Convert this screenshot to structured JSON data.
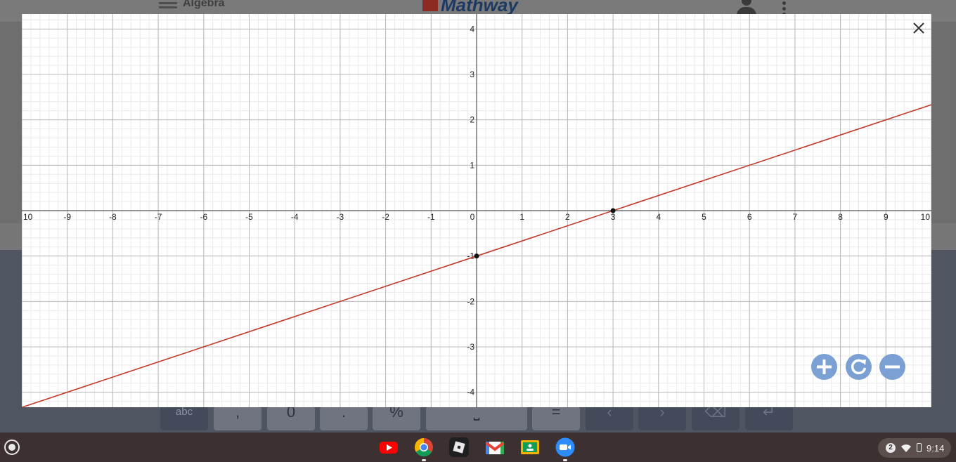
{
  "background_app": {
    "section_title": "Algebra",
    "logo_text": "Mathway",
    "keypad": [
      ",",
      "0",
      ".",
      "%",
      "⎵",
      "="
    ],
    "keypad_mode_label": "abc",
    "nav_keys": [
      "‹",
      "›",
      "⌫",
      "↵"
    ]
  },
  "graph": {
    "x_range": [
      -10,
      10
    ],
    "y_range": [
      -4.33,
      4.33
    ],
    "x_tick_labels": [
      "10",
      "-9",
      "-8",
      "-7",
      "-6",
      "-5",
      "-4",
      "-3",
      "-2",
      "-1",
      "0",
      "1",
      "2",
      "3",
      "4",
      "5",
      "6",
      "7",
      "8",
      "9",
      "10"
    ],
    "y_tick_labels_positive": [
      "1",
      "2",
      "3",
      "4"
    ],
    "y_tick_labels_negative": [
      "-1",
      "-2",
      "-3",
      "-4"
    ],
    "line": {
      "slope": 0.3333,
      "intercept": -1,
      "color": "#c0392b"
    },
    "points": [
      {
        "x": 0,
        "y": -1
      },
      {
        "x": 3,
        "y": 0
      }
    ],
    "minor_grid_step": 0.2,
    "grid": true
  },
  "controls": {
    "close": "close-icon",
    "zoom_in": "plus-icon",
    "reset": "refresh-icon",
    "zoom_out": "minus-icon",
    "accent_color": "#7aa0d4"
  },
  "shelf": {
    "apps": [
      "YouTube",
      "Chrome",
      "Roblox",
      "Gmail",
      "Google Classroom",
      "Zoom"
    ],
    "notification_count": "2",
    "time": "9:14"
  }
}
